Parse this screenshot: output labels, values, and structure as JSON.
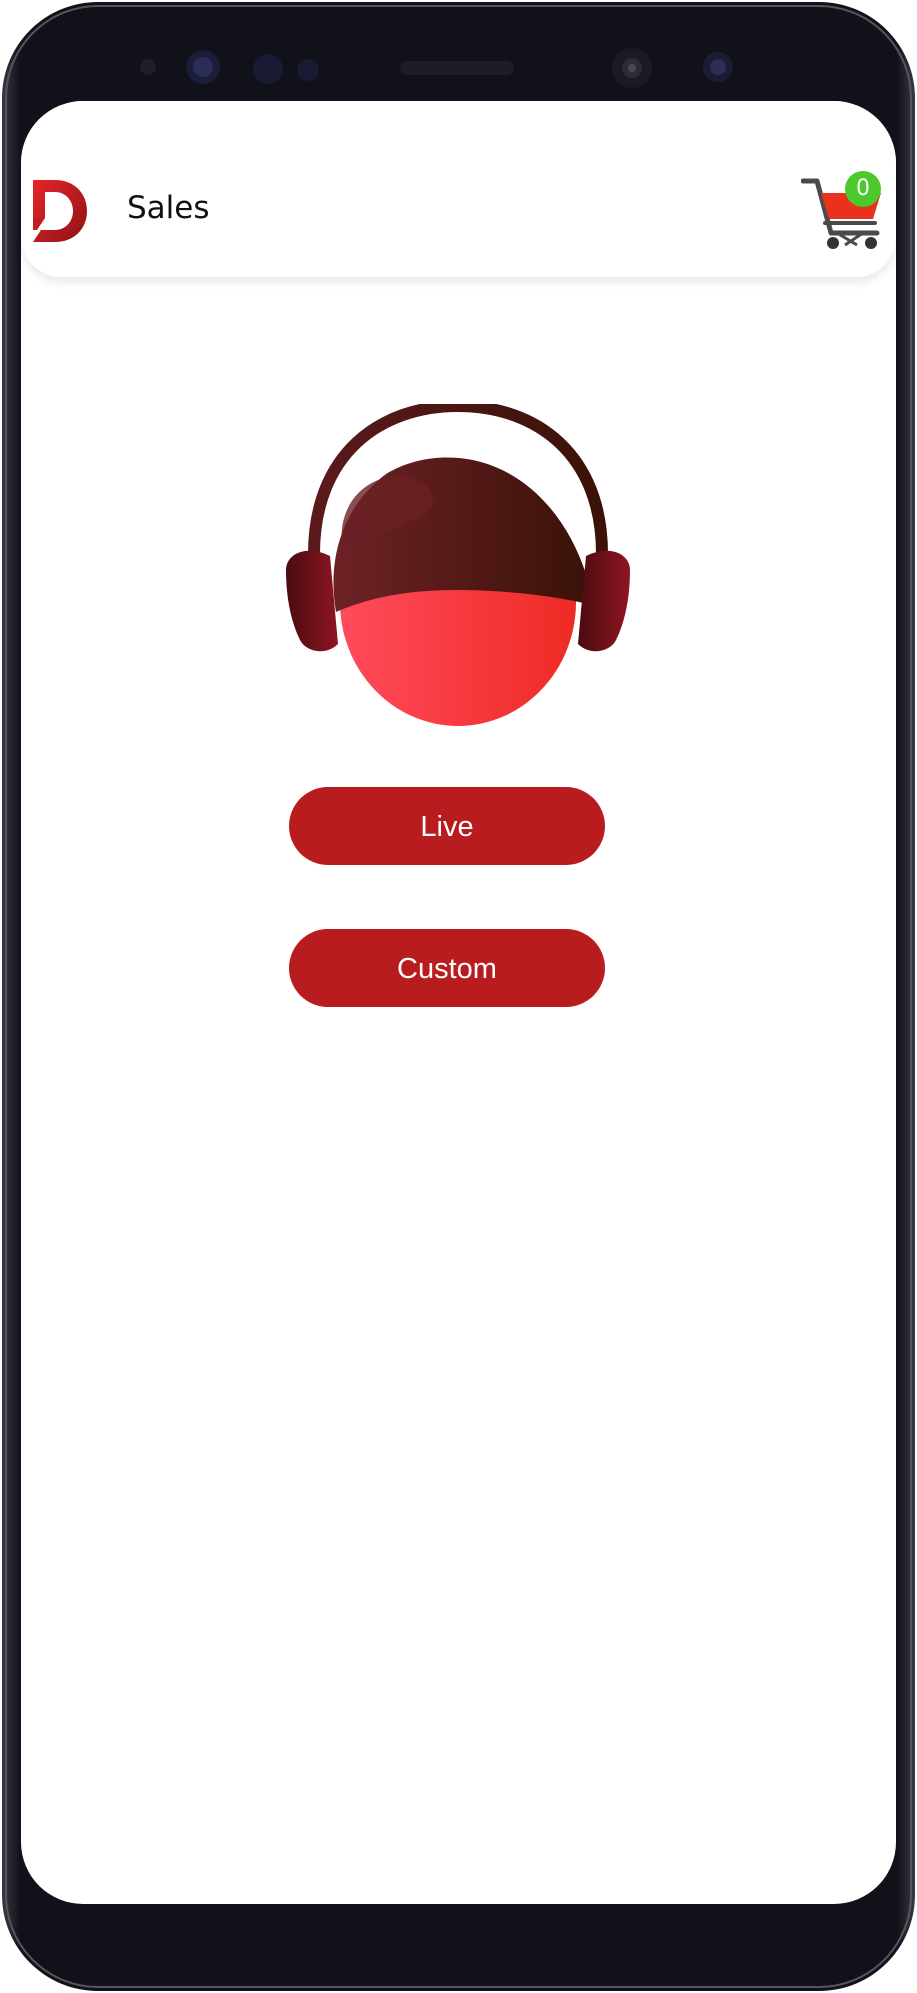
{
  "header": {
    "title": "Sales",
    "cart_count": "0",
    "logo_icon": "app-logo-d",
    "cart_icon": "shopping-cart-icon"
  },
  "main": {
    "avatar_icon": "support-agent-headphones-icon",
    "live_label": "Live",
    "custom_label": "Custom"
  },
  "colors": {
    "accent": "#b91c1f",
    "badge": "#4cc92b",
    "device_bezel": "#0f0f17",
    "face": "#ff3b3f",
    "hair": "#4a1516"
  }
}
